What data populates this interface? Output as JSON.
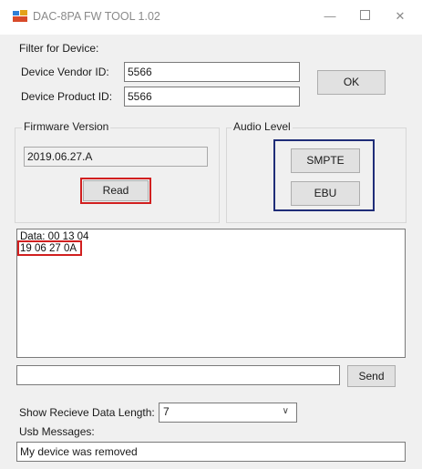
{
  "window": {
    "title": "DAC-8PA FW TOOL 1.02",
    "minimize_glyph": "—",
    "close_glyph": "✕"
  },
  "filter": {
    "group_label": "Filter for Device:",
    "vendor_label": "Device Vendor ID:",
    "vendor_value": "5566",
    "product_label": "Device Product ID:",
    "product_value": "5566",
    "ok_label": "OK"
  },
  "firmware": {
    "group_label": "Firmware Version",
    "version_value": "2019.06.27.A",
    "read_label": "Read"
  },
  "audio_level": {
    "group_label": "Audio Level",
    "smpte_label": "SMPTE",
    "ebu_label": "EBU"
  },
  "data_log": {
    "line1": "Data: 00 13 04",
    "line2": "19 06 27 0A"
  },
  "send": {
    "input_value": "",
    "button_label": "Send"
  },
  "receive_length": {
    "label": "Show Recieve Data Length:",
    "selected": "7"
  },
  "usb": {
    "label": "Usb Messages:",
    "message": "My device was removed"
  },
  "colors": {
    "highlight_red": "#d11f1f",
    "highlight_blue": "#1f2d78",
    "window_bg": "#f0f0f0"
  }
}
